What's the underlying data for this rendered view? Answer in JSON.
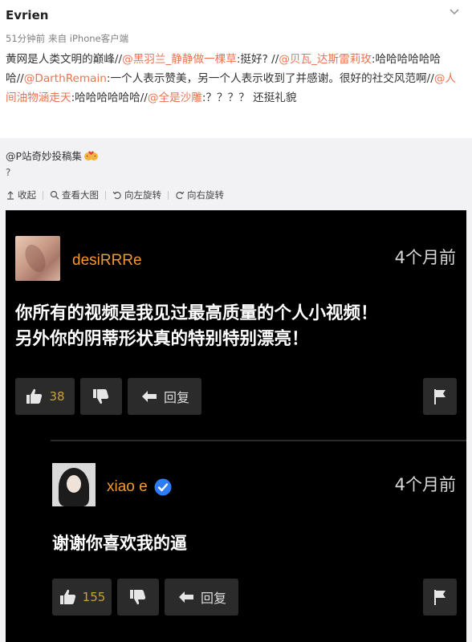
{
  "post": {
    "author": "Evrien",
    "time": "51分钟前",
    "source": "来自 iPhone客户端",
    "text": [
      {
        "t": "黄网是人类文明的巅峰//"
      },
      {
        "t": "@黑羽兰_静静做一棵草",
        "mention": true
      },
      {
        "t": ":挺好? //"
      },
      {
        "t": "@贝瓦_达斯雷莉玫",
        "mention": true
      },
      {
        "t": ":哈哈哈哈哈哈哈//"
      },
      {
        "t": "@DarthRemain",
        "mention": true
      },
      {
        "t": ":一个人表示赞美，另一个人表示收到了并感谢。很好的社交风范啊//"
      },
      {
        "t": "@人间油物涵走天",
        "mention": true
      },
      {
        "t": ":哈哈哈哈哈哈//"
      },
      {
        "t": "@全是沙雕",
        "mention": true
      },
      {
        "t": ":？？？？ 还挺礼貌"
      }
    ]
  },
  "repost": {
    "title": "@P站奇妙投稿集",
    "emoji": "kiss-emoji",
    "text": "?",
    "actions": {
      "collapse": "收起",
      "view_large": "查看大图",
      "rotate_left": "向左旋转",
      "rotate_right": "向右旋转"
    }
  },
  "screenshot": {
    "comment1": {
      "username": "desiRRRe",
      "time": "4个月前",
      "text_line1": "你所有的视频是我见过最高质量的个人小视频！",
      "text_line2": "另外你的阴蒂形状真的特别特别漂亮！",
      "likes": "38",
      "reply_label": "回复"
    },
    "comment2": {
      "username": "xiao e",
      "time": "4个月前",
      "text": "谢谢你喜欢我的逼",
      "likes": "155",
      "reply_label": "回复"
    }
  },
  "colors": {
    "mention": "#eb7350",
    "username": "#f19a2e",
    "like_count": "#c8a23c",
    "verified": "#2d7cf6",
    "button_bg": "#2b2b2b"
  }
}
